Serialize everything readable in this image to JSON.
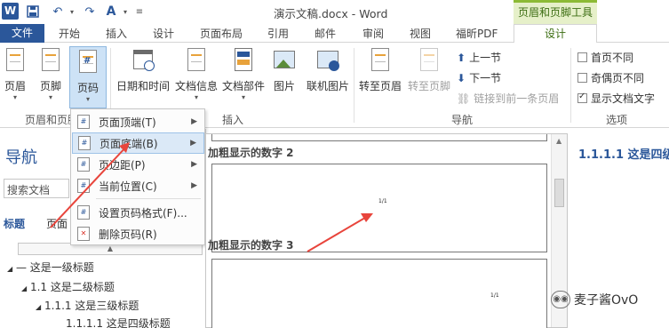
{
  "titlebar": {
    "app_icon": "W",
    "title": "演示文稿.docx - Word",
    "context_tab_group": "页眉和页脚工具"
  },
  "tabs": {
    "file": "文件",
    "items": [
      "开始",
      "插入",
      "设计",
      "页面布局",
      "引用",
      "邮件",
      "审阅",
      "视图",
      "福昕PDF"
    ],
    "design": "设计"
  },
  "ribbon": {
    "header": "页眉",
    "footer": "页脚",
    "page_number": "页码",
    "date_time": "日期和时间",
    "doc_info": "文档信息",
    "doc_parts": "文档部件",
    "picture": "图片",
    "online_picture": "联机图片",
    "goto_header": "转至页眉",
    "goto_footer": "转至页脚",
    "prev_section": "上一节",
    "next_section": "下一节",
    "link_previous": "链接到前一条页眉",
    "different_first": "首页不同",
    "different_odd_even": "奇偶页不同",
    "show_doc_text": "显示文档文字",
    "group_header_footer": "页眉和页脚",
    "group_insert": "插入",
    "group_navigation": "导航",
    "group_options": "选项"
  },
  "nav": {
    "title": "导航",
    "search_placeholder": "搜索文档",
    "tab_headings": "标题",
    "tab_pages": "页面",
    "tree": [
      "— 这是一级标题",
      "1.1 这是二级标题",
      "1.1.1 这是三级标题",
      "1.1.1.1 这是四级标题"
    ]
  },
  "menu": {
    "items": [
      {
        "label": "页面顶端(T)"
      },
      {
        "label": "页面底端(B)"
      },
      {
        "label": "页边距(P)"
      },
      {
        "label": "当前位置(C)"
      },
      {
        "label": "设置页码格式(F)..."
      },
      {
        "label": "删除页码(R)"
      }
    ]
  },
  "gallery": {
    "item1": "加粗显示的数字 2",
    "item2": "加粗显示的数字 3",
    "sample_num": "1/1"
  },
  "document": {
    "heading": "1.1.1.1 这是四级标题"
  },
  "watermark": {
    "text": "麦子酱OvO",
    "icon": "wechat-icon"
  },
  "colors": {
    "word_blue": "#2b579a",
    "context_green": "#8cba35",
    "arrow_red": "#e8453c"
  }
}
